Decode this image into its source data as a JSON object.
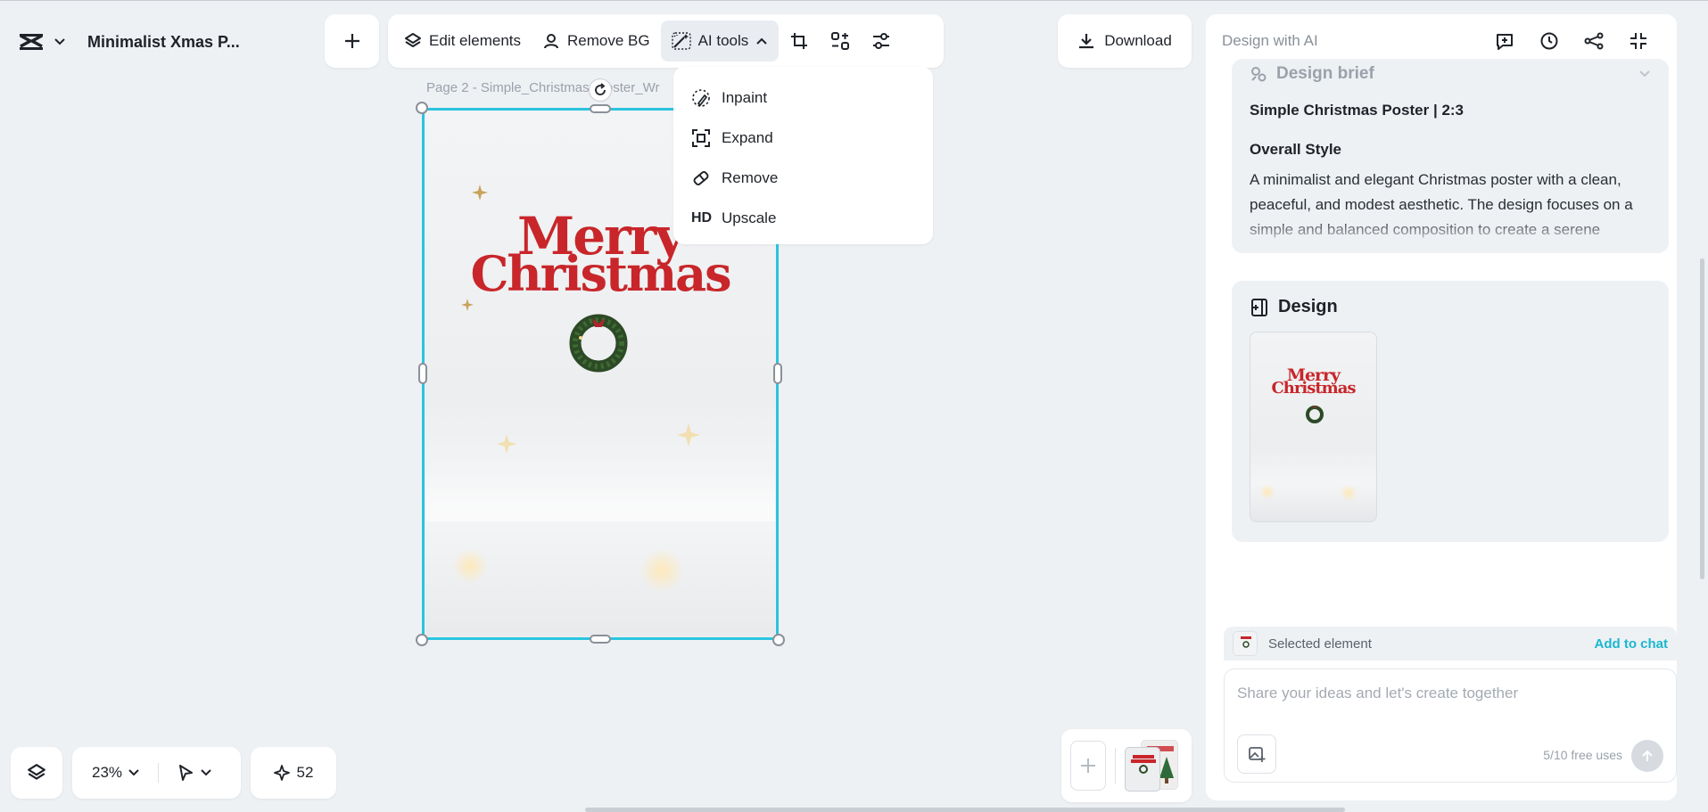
{
  "header": {
    "doc_title": "Minimalist Xmas P..."
  },
  "toolbar": {
    "edit_elements": "Edit elements",
    "remove_bg": "Remove BG",
    "ai_tools": "AI tools",
    "download": "Download"
  },
  "ai_menu": {
    "items": [
      {
        "label": "Inpaint",
        "icon": "inpaint-icon"
      },
      {
        "label": "Expand",
        "icon": "expand-icon"
      },
      {
        "label": "Remove",
        "icon": "eraser-icon"
      },
      {
        "label": "Upscale",
        "icon": "hd-icon",
        "icon_text": "HD"
      }
    ]
  },
  "canvas": {
    "page_label": "Page 2 -  Simple_Christmas_Poster_Wr",
    "poster_line1": "Merry",
    "poster_line2": "Christmas",
    "poster_color": "#c8262a",
    "selection_color": "#2bc4de"
  },
  "bottom_bar": {
    "zoom": "23%",
    "credits": "52"
  },
  "right_panel": {
    "title": "Design with AI",
    "brief": {
      "heading": "Design brief",
      "subtitle": "Simple Christmas Poster | 2:3",
      "style_heading": "Overall Style",
      "description": "A minimalist and elegant Christmas poster with a clean, peaceful, and modest aesthetic. The design focuses on a simple and balanced composition to create a serene"
    },
    "design": {
      "heading": "Design",
      "thumb_line1": "Merry",
      "thumb_line2": "Christmas"
    },
    "selected_label": "Selected element",
    "add_to_chat": "Add to chat",
    "chat_placeholder": "Share your ideas and let's create together",
    "free_uses": "5/10 free uses",
    "accent": "#19b7d0"
  }
}
